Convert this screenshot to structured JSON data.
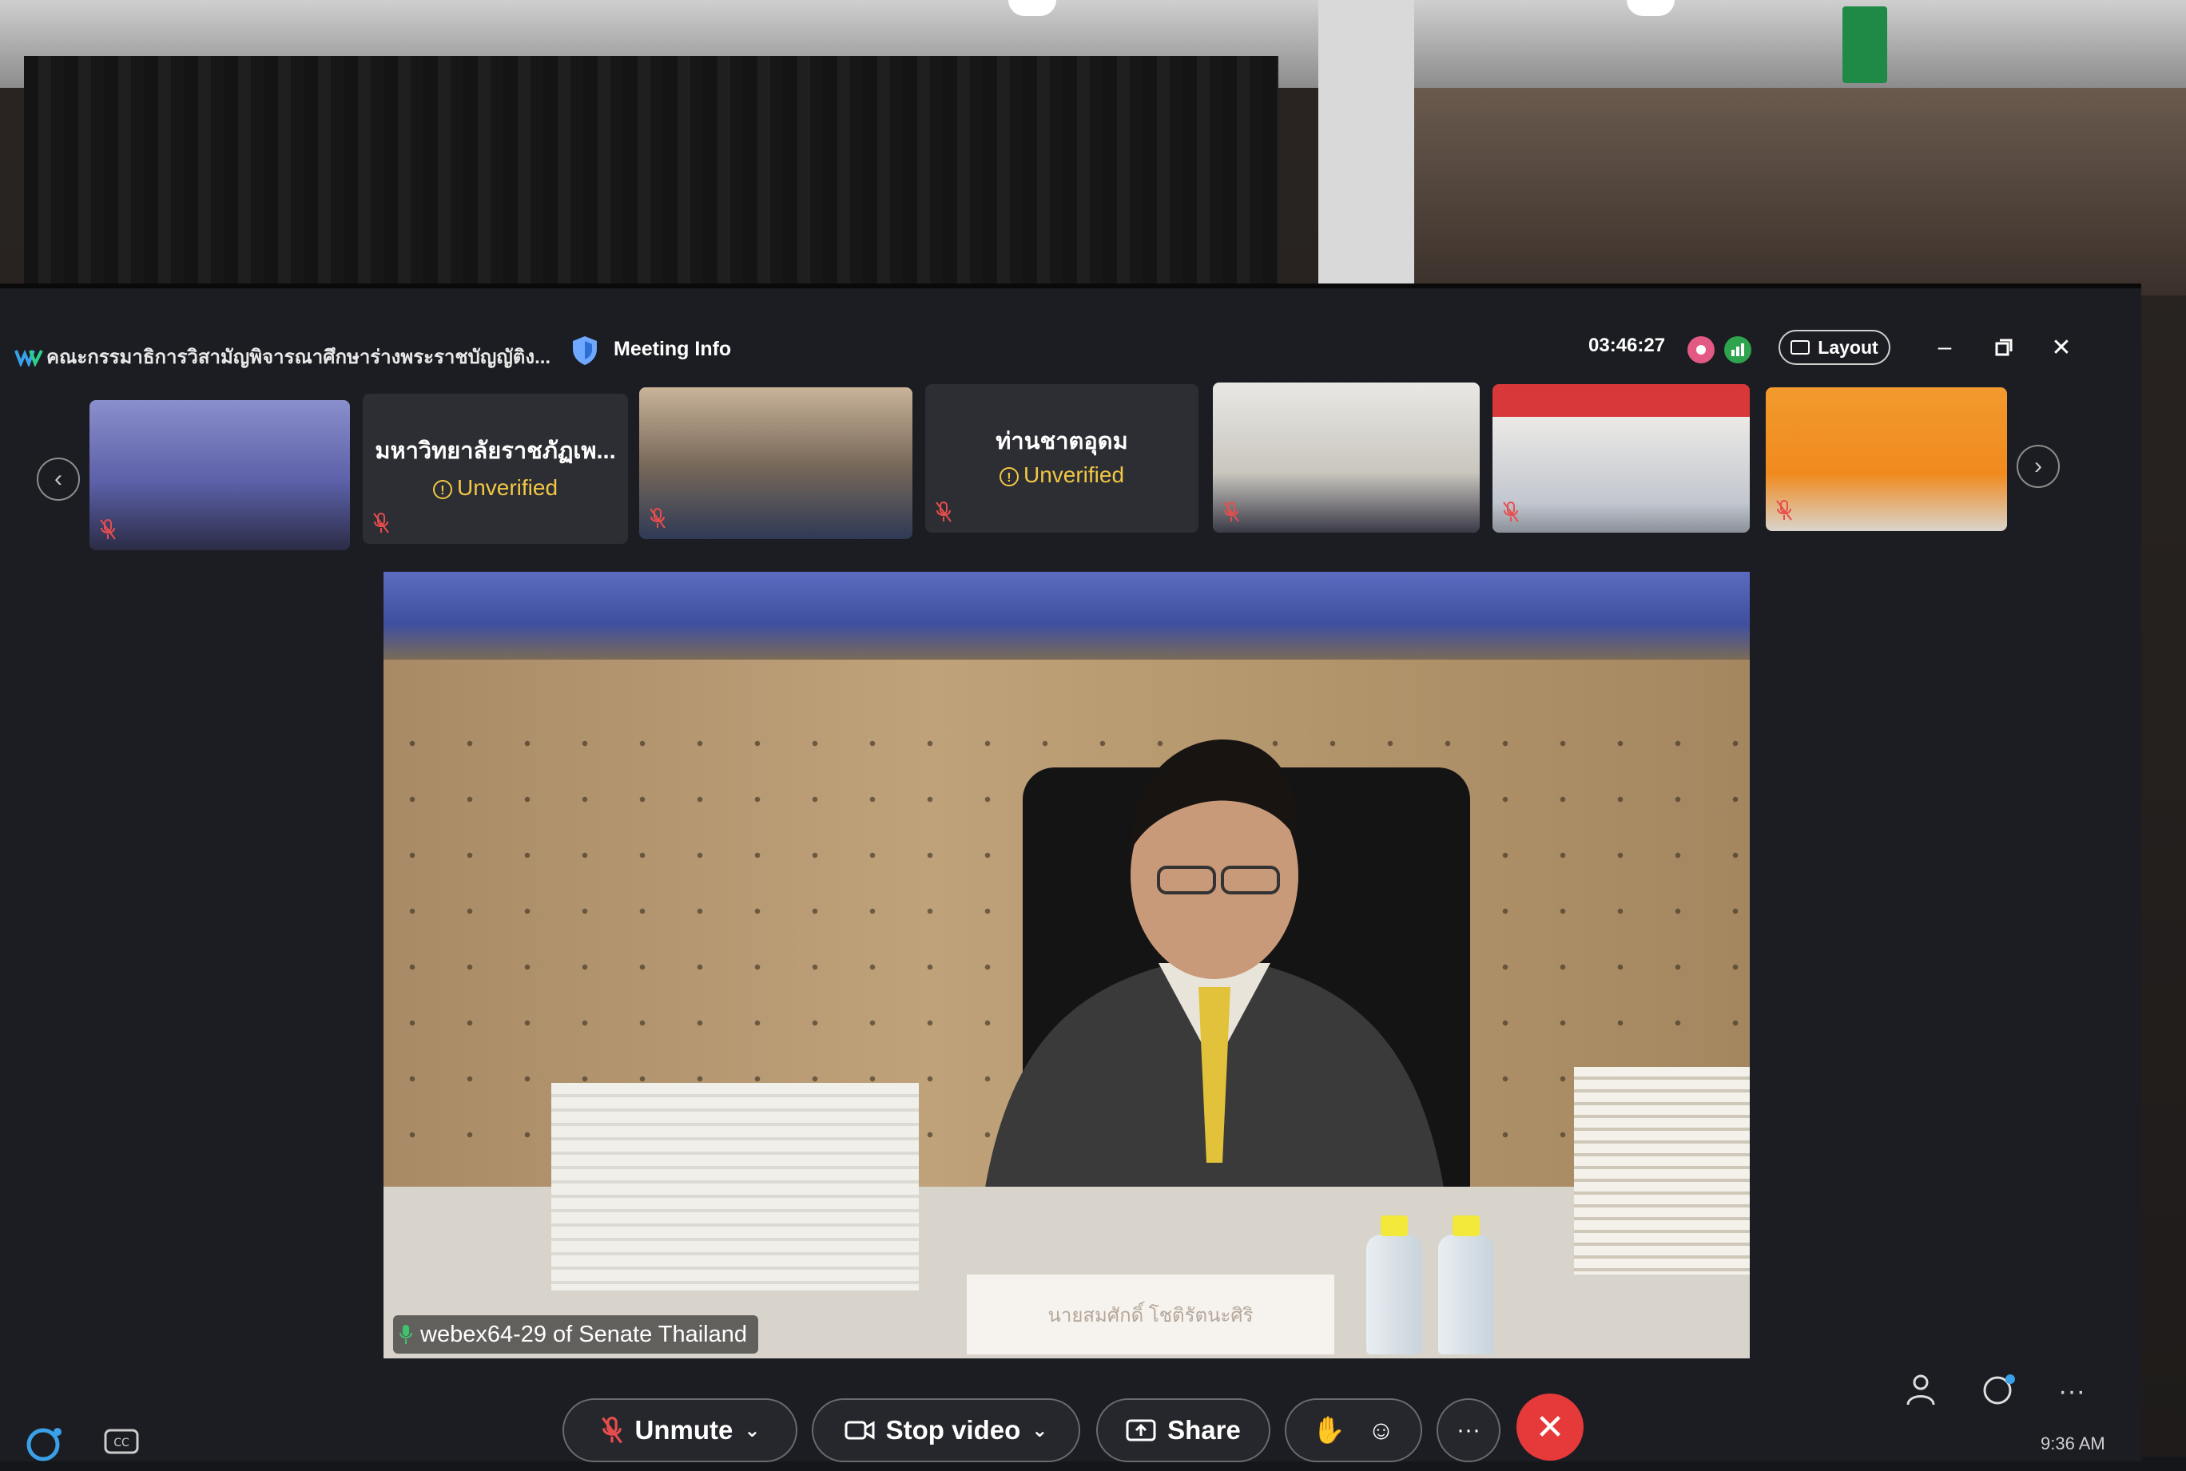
{
  "window": {
    "title": "คณะกรรมาธิการวิสามัญพิจารณาศึกษาร่างพระราชบัญญัติง...",
    "meeting_info": "Meeting Info",
    "timer": "03:46:27",
    "layout_label": "Layout"
  },
  "thumbnails": [
    {
      "name": "",
      "badge": "",
      "type": "video"
    },
    {
      "name": "มหาวิทยาลัยราชภัฏเพ...",
      "badge": "Unverified",
      "type": "avatar"
    },
    {
      "name": "",
      "badge": "",
      "type": "video"
    },
    {
      "name": "ท่านชาตอุดม",
      "badge": "Unverified",
      "type": "avatar"
    },
    {
      "name": "",
      "badge": "",
      "type": "video"
    },
    {
      "name": "",
      "badge": "",
      "type": "video"
    },
    {
      "name": "",
      "badge": "",
      "type": "video"
    }
  ],
  "main_video": {
    "label": "webex64-29 of Senate Thailand",
    "nameplate_name": "นายสมศักดิ์ โชติรัตนะศิริ"
  },
  "controls": {
    "unmute_label": "Unmute",
    "stop_video_label": "Stop video",
    "share_label": "Share",
    "more_label": "···"
  },
  "status": {
    "clock": "9:36 AM"
  },
  "colors": {
    "accent_unverified": "#f2c744",
    "end_call": "#e63a3a",
    "recording": "#e25a84",
    "network": "#2fa44f"
  },
  "icons": [
    "webex-logo-icon",
    "shield-icon",
    "recording-icon",
    "network-icon",
    "layout-icon",
    "minimize-icon",
    "restore-icon",
    "close-icon",
    "chevron-left-icon",
    "chevron-right-icon",
    "muted-mic-icon",
    "mic-icon",
    "video-camera-icon",
    "share-icon",
    "raise-hand-icon",
    "reactions-icon",
    "more-icon",
    "end-call-icon",
    "participants-icon",
    "chat-icon",
    "captions-icon",
    "assistant-icon"
  ]
}
